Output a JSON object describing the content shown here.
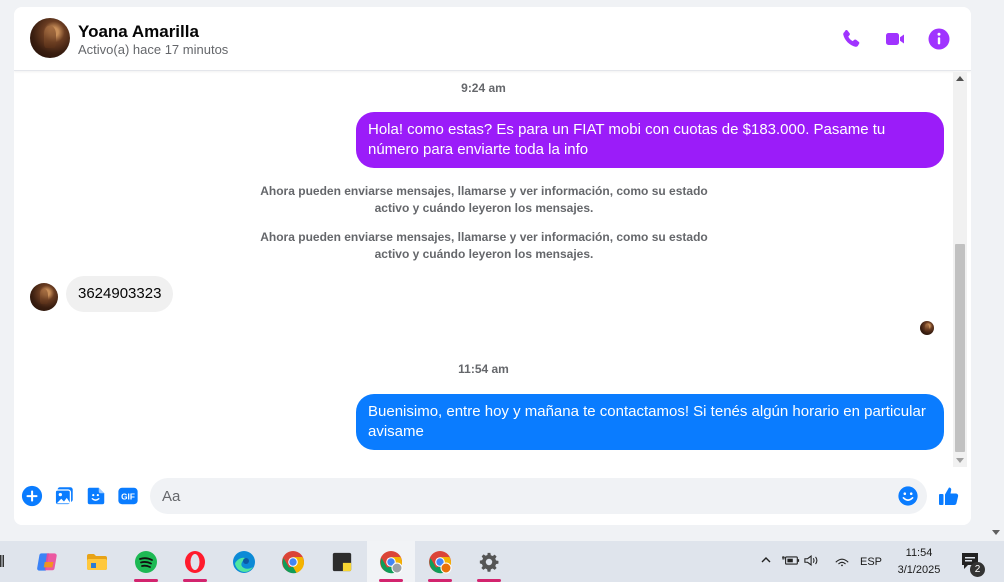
{
  "header": {
    "name": "Yoana Amarilla",
    "status": "Activo(a) hace 17 minutos",
    "accent_color": "#a033ff"
  },
  "messages": {
    "ts1": "9:24 am",
    "msg1": "Hola! como estas? Es para un FIAT mobi con cuotas de $183.000. Pasame tu número para enviarte toda la info",
    "sys1": "Ahora pueden enviarse mensajes, llamarse y ver información, como su estado activo y cuándo leyeron los mensajes.",
    "sys2": "Ahora pueden enviarse mensajes, llamarse y ver información, como su estado activo y cuándo leyeron los mensajes.",
    "incoming": "3624903323",
    "ts2": "11:54 am",
    "msg2": "Buenisimo, entre hoy y mañana te contactamos! Si tenés algún horario en particular avisame",
    "outgoing_purple": "#9b1cf9",
    "outgoing_blue": "#0a7cff"
  },
  "composer": {
    "placeholder": "Aa"
  },
  "taskbar": {
    "language": "ESP",
    "time": "11:54",
    "date": "3/1/2025",
    "notifications": "2"
  }
}
